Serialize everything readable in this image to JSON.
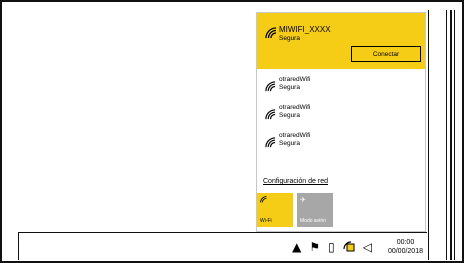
{
  "network_panel": {
    "selected_network": {
      "name": "MIWIFI_XXXX",
      "status": "Segura",
      "connect_label": "Conectar"
    },
    "networks": [
      {
        "name": "otraredWifi",
        "status": "Segura"
      },
      {
        "name": "otraredWifi",
        "status": "Segura"
      },
      {
        "name": "otraredWifi",
        "status": "Segura"
      }
    ],
    "settings_link": "Configuración de red",
    "quick_actions": [
      {
        "label": "Wi-Fi",
        "icon": "wifi-icon",
        "state": "on",
        "color": "#f5cc16"
      },
      {
        "label": "Modo avión",
        "icon": "airplane-icon",
        "state": "off",
        "color": "#a7a7a7"
      }
    ]
  },
  "taskbar": {
    "tray_icons": [
      "chevron-up-icon",
      "flag-icon",
      "battery-icon",
      "network-icon",
      "speaker-icon"
    ],
    "clock": {
      "time": "00:00",
      "date": "00/00/2018"
    }
  },
  "colors": {
    "accent": "#f5cc16",
    "tile_off": "#a7a7a7"
  }
}
